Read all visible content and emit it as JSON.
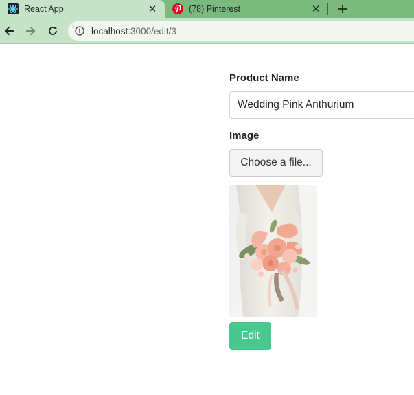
{
  "browser": {
    "tabs": [
      {
        "title": "React App",
        "icon": "react-icon",
        "active": true
      },
      {
        "title": "(78) Pinterest",
        "icon": "pinterest-icon",
        "active": false
      }
    ],
    "url": {
      "host": "localhost",
      "path": ":3000/edit/3"
    },
    "colors": {
      "tabstrip": "#7aba7e",
      "active_tab": "#c5e3c6"
    }
  },
  "form": {
    "product_name_label": "Product Name",
    "product_name_value": "Wedding Pink Anthurium",
    "image_label": "Image",
    "file_button_label": "Choose a file...",
    "submit_label": "Edit"
  },
  "colors": {
    "submit_button": "#48c78e"
  }
}
